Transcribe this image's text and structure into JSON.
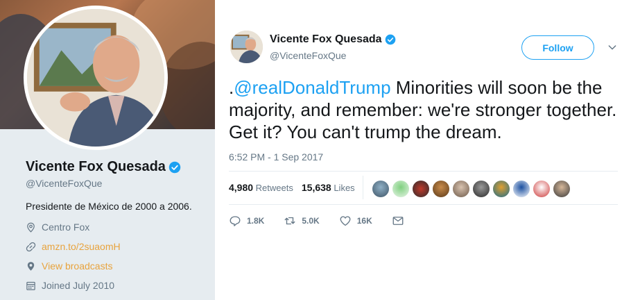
{
  "profile": {
    "name": "Vicente Fox Quesada",
    "handle": "@VicenteFoxQue",
    "bio": "Presidente de México de 2000 a 2006.",
    "location": "Centro Fox",
    "website": "amzn.to/2suaomH",
    "broadcasts": "View broadcasts",
    "joined": "Joined July 2010"
  },
  "tweet": {
    "author_name": "Vicente Fox Quesada",
    "author_handle": "@VicenteFoxQue",
    "follow_label": "Follow",
    "text_prefix": ".",
    "mention": "@realDonaldTrump",
    "text_body": " Minorities will soon be the majority, and remember: we're stronger together. Get it? You can't trump the dream.",
    "timestamp": "6:52 PM - 1 Sep 2017",
    "retweets_count": "4,980",
    "retweets_label": "Retweets",
    "likes_count": "15,638",
    "likes_label": "Likes",
    "actions": {
      "reply": "1.8K",
      "retweet": "5.0K",
      "like": "16K"
    }
  },
  "colors": {
    "accent": "#1da1f2",
    "link": "#e8a33d",
    "muted": "#657786",
    "panel": "#e6ecf0"
  },
  "icons": [
    "verified-icon",
    "location-icon",
    "link-icon",
    "broadcast-icon",
    "calendar-icon",
    "chevron-down-icon",
    "reply-icon",
    "retweet-icon",
    "like-icon",
    "message-icon"
  ]
}
